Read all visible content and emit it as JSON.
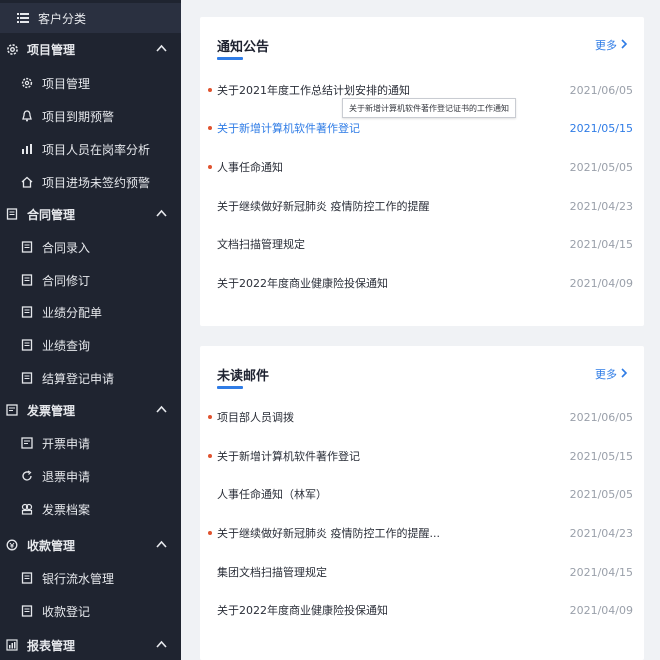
{
  "sidebar": {
    "items": [
      {
        "type": "top",
        "label": "客户分类",
        "icon": "list-icon"
      },
      {
        "type": "group",
        "label": "项目管理",
        "icon": "gear-icon"
      },
      {
        "type": "child",
        "label": "项目管理",
        "icon": "gear-icon"
      },
      {
        "type": "child",
        "label": "项目到期预警",
        "icon": "bell-icon"
      },
      {
        "type": "child",
        "label": "项目人员在岗率分析",
        "icon": "chart-icon"
      },
      {
        "type": "child",
        "label": "项目进场未签约预警",
        "icon": "home-icon"
      },
      {
        "type": "group",
        "label": "合同管理",
        "icon": "document-icon"
      },
      {
        "type": "child",
        "label": "合同录入",
        "icon": "document-icon"
      },
      {
        "type": "child",
        "label": "合同修订",
        "icon": "document-icon"
      },
      {
        "type": "child",
        "label": "业绩分配单",
        "icon": "document-icon"
      },
      {
        "type": "child",
        "label": "业绩查询",
        "icon": "document-icon"
      },
      {
        "type": "child",
        "label": "结算登记申请",
        "icon": "document-icon"
      },
      {
        "type": "group",
        "label": "发票管理",
        "icon": "invoice-icon"
      },
      {
        "type": "child",
        "label": "开票申请",
        "icon": "invoice-icon"
      },
      {
        "type": "child",
        "label": "退票申请",
        "icon": "refresh-icon"
      },
      {
        "type": "child",
        "label": "发票档案",
        "icon": "archive-icon"
      },
      {
        "type": "group",
        "label": "收款管理",
        "icon": "coin-icon"
      },
      {
        "type": "child",
        "label": "银行流水管理",
        "icon": "document-icon"
      },
      {
        "type": "child",
        "label": "收款登记",
        "icon": "document-icon"
      },
      {
        "type": "group",
        "label": "报表管理",
        "icon": "chart-icon"
      }
    ]
  },
  "notices": {
    "title": "通知公告",
    "more": "更多",
    "tooltip": "关于新增计算机软件著作登记证书的工作通知",
    "items": [
      {
        "title": "关于2021年度工作总结计划安排的通知",
        "date": "2021/06/05",
        "unread": true,
        "highlight": false
      },
      {
        "title": "关于新增计算机软件著作登记",
        "date": "2021/05/15",
        "unread": true,
        "highlight": true
      },
      {
        "title": "人事任命通知",
        "date": "2021/05/05",
        "unread": true,
        "highlight": false
      },
      {
        "title": "关于继续做好新冠肺炎 疫情防控工作的提醒",
        "date": "2021/04/23",
        "unread": false,
        "highlight": false
      },
      {
        "title": "文档扫描管理规定",
        "date": "2021/04/15",
        "unread": false,
        "highlight": false
      },
      {
        "title": "关于2022年度商业健康险投保通知",
        "date": "2021/04/09",
        "unread": false,
        "highlight": false
      }
    ]
  },
  "mails": {
    "title": "未读邮件",
    "more": "更多",
    "items": [
      {
        "title": "项目部人员调拨",
        "date": "2021/06/05",
        "unread": true
      },
      {
        "title": "关于新增计算机软件著作登记",
        "date": "2021/05/15",
        "unread": true
      },
      {
        "title": "人事任命通知（林军）",
        "date": "2021/05/05",
        "unread": false
      },
      {
        "title": "关于继续做好新冠肺炎 疫情防控工作的提醒...",
        "date": "2021/04/23",
        "unread": true
      },
      {
        "title": "集团文档扫描管理规定",
        "date": "2021/04/15",
        "unread": false
      },
      {
        "title": "关于2022年度商业健康险投保通知",
        "date": "2021/04/09",
        "unread": false
      }
    ]
  },
  "colors": {
    "sidebar_bg": "#1f2430",
    "accent": "#2f7ce6",
    "unread_dot": "#e0532f",
    "page_bg": "#f0f2f5"
  }
}
